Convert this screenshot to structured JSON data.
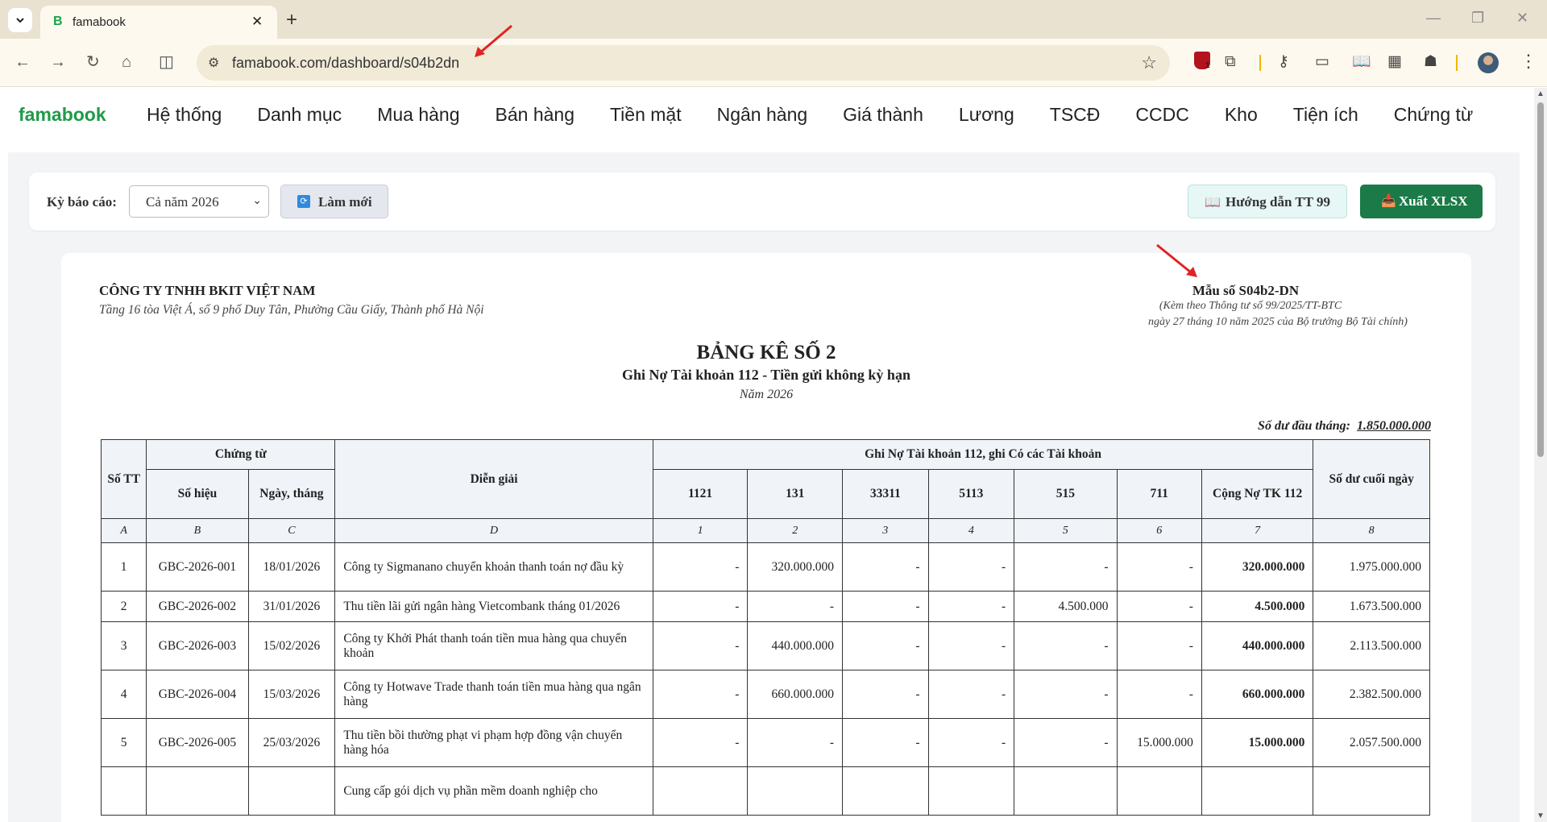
{
  "browser": {
    "tab_title": "famabook",
    "tab_favicon": "B",
    "url": "famabook.com/dashboard/s04b2dn",
    "extension_badge_count": "1"
  },
  "app": {
    "brand": "famabook",
    "menu": [
      "Hệ thống",
      "Danh mục",
      "Mua hàng",
      "Bán hàng",
      "Tiền mặt",
      "Ngân hàng",
      "Giá thành",
      "Lương",
      "TSCĐ",
      "CCDC",
      "Kho",
      "Tiện ích",
      "Chứng từ"
    ]
  },
  "filter": {
    "label": "Kỳ báo cáo:",
    "period_value": "Cả năm 2026",
    "refresh_label": "Làm mới",
    "guide_label": "Hướng dẫn TT 99",
    "export_label": "Xuất XLSX"
  },
  "report": {
    "company": "CÔNG TY TNHH BKIT VIỆT NAM",
    "address": "Tầng 16 tòa Việt Á, số 9 phố Duy Tân, Phường Cầu Giấy, Thành phố Hà Nội",
    "form_no": "Mẫu số S04b2-DN",
    "form_ref1": "(Kèm theo Thông tư số 99/2025/TT-BTC",
    "form_ref2": "ngày 27 tháng 10 năm 2025 của Bộ trưởng Bộ Tài chính)",
    "title": "BẢNG KÊ SỐ 2",
    "subtitle": "Ghi Nợ Tài khoản 112 - Tiền gửi không kỳ hạn",
    "year": "Năm 2026",
    "opening_label": "Số dư đầu tháng:",
    "opening_amount": "1.850.000.000"
  },
  "table": {
    "h_stt": "Số TT",
    "h_voucher": "Chứng từ",
    "h_voucher_no": "Số hiệu",
    "h_voucher_date": "Ngày, tháng",
    "h_desc": "Diễn giải",
    "h_group": "Ghi Nợ Tài khoản 112, ghi Có các Tài khoản",
    "h_accounts": [
      "1121",
      "131",
      "33311",
      "5113",
      "515",
      "711"
    ],
    "h_total": "Cộng Nợ TK 112",
    "h_balance": "Số dư cuối ngày",
    "letters": [
      "A",
      "B",
      "C",
      "D",
      "1",
      "2",
      "3",
      "4",
      "5",
      "6",
      "7",
      "8"
    ],
    "rows": [
      {
        "stt": "1",
        "no": "GBC-2026-001",
        "date": "18/01/2026",
        "desc": "Công ty Sigmanano chuyển khoản thanh toán nợ đầu kỳ",
        "a1121": "-",
        "a131": "320.000.000",
        "a33311": "-",
        "a5113": "-",
        "a515": "-",
        "a711": "-",
        "total": "320.000.000",
        "balance": "1.975.000.000"
      },
      {
        "stt": "2",
        "no": "GBC-2026-002",
        "date": "31/01/2026",
        "desc": "Thu tiền lãi gửi ngân hàng Vietcombank tháng 01/2026",
        "a1121": "-",
        "a131": "-",
        "a33311": "-",
        "a5113": "-",
        "a515": "4.500.000",
        "a711": "-",
        "total": "4.500.000",
        "balance": "1.673.500.000"
      },
      {
        "stt": "3",
        "no": "GBC-2026-003",
        "date": "15/02/2026",
        "desc": "Công ty Khởi Phát thanh toán tiền mua hàng qua chuyển khoản",
        "a1121": "-",
        "a131": "440.000.000",
        "a33311": "-",
        "a5113": "-",
        "a515": "-",
        "a711": "-",
        "total": "440.000.000",
        "balance": "2.113.500.000"
      },
      {
        "stt": "4",
        "no": "GBC-2026-004",
        "date": "15/03/2026",
        "desc": "Công ty Hotwave Trade thanh toán tiền mua hàng qua ngân hàng",
        "a1121": "-",
        "a131": "660.000.000",
        "a33311": "-",
        "a5113": "-",
        "a515": "-",
        "a711": "-",
        "total": "660.000.000",
        "balance": "2.382.500.000"
      },
      {
        "stt": "5",
        "no": "GBC-2026-005",
        "date": "25/03/2026",
        "desc": "Thu tiền bồi thường phạt vi phạm hợp đồng vận chuyển hàng hóa",
        "a1121": "-",
        "a131": "-",
        "a33311": "-",
        "a5113": "-",
        "a515": "-",
        "a711": "15.000.000",
        "total": "15.000.000",
        "balance": "2.057.500.000"
      },
      {
        "stt": "",
        "no": "",
        "date": "",
        "desc": "Cung cấp gói dịch vụ phần mềm doanh nghiệp cho",
        "a1121": "",
        "a131": "",
        "a33311": "",
        "a5113": "",
        "a515": "",
        "a711": "",
        "total": "",
        "balance": ""
      }
    ]
  }
}
